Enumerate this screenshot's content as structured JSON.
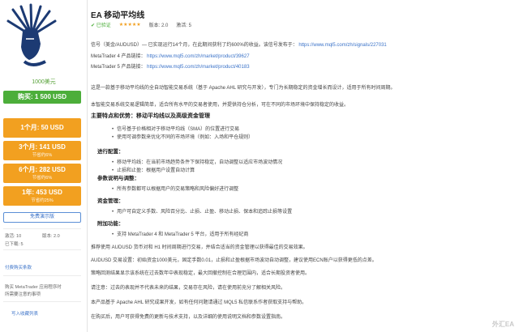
{
  "sidebar": {
    "price_label": "1000美元",
    "buy_label": "购买: 1 500 USD",
    "rent_options": [
      {
        "main": "1个月: 50 USD",
        "sub": ""
      },
      {
        "main": "3个月: 141 USD",
        "sub": "节省约6%"
      },
      {
        "main": "6个月: 282 USD",
        "sub": "节省约6%"
      },
      {
        "main": "1年: 453 USD",
        "sub": "节省约25%"
      }
    ],
    "demo_label": "免费演示版",
    "activations": "激活: 10",
    "version_label": "版本: 2.0",
    "downloads_label": "已下载: 5",
    "terms_link": "付费购买条款",
    "info_1": "购买 MetaTrader 应用程序时",
    "info_2": "所需要注意的事项",
    "subscribe_link": "写入收藏列表"
  },
  "header": {
    "title": "EA 移动平均线",
    "verified": "✔ 已验证",
    "version": "版本: 2.0",
    "activations": "激活: 5",
    "stars": "★★★★★"
  },
  "body": {
    "p1": "信号（美金/AUDUSD）— 已实现运行14个月，在此期间获利了约600%的收益。该信号发布于：",
    "p1_link": "https://www.mql5.com/zh/signals/227031",
    "p2_label": "MetaTrader 4 产品链接：",
    "p2_link": "https://www.mql5.com/zh/market/product/39627",
    "p3_label": "MetaTrader 5 产品链接：",
    "p3_link": "https://www.mql5.com/zh/market/product/40183",
    "p4": "这是一款基于移动平均线的全自动智能交易系统（基于 Apache AHL 研究与开发），专门为长期稳定的资金增长而设计，适用于所有时间周期。",
    "p5": "本智能交易系统交易逻辑简单，适合所有水平的交易者使用，并提供持仓分析，可在不同的市场环境中保持稳定的收益。",
    "h1": "主要特点和优势：移动平均线以及高级资金管理",
    "b1": "信号基于价格相对于移动平均线（SMA）的位置进行交易",
    "b2": "使用可调参数来优化不同的市场环境（例如：入场和平仓规则）",
    "h2": "进行配置：",
    "b3": "移动平均线：在当前市场趋势条件下保持稳定，自动调整以适应市场波动情况",
    "b4": "止损和止盈：根据用户设置自动计算",
    "h3": "参数说明与调整：",
    "b5": "所有参数都可以根据用户的交易策略和风险偏好进行调整",
    "h4": "资金管理：",
    "b6": "用户可自定义手数、风险百分比、止损、止盈、移动止损、保本和追踪止损等设置",
    "h5": "附加功能：",
    "b7": "支持 MetaTrader 4 和 MetaTrader 5 平台，适用于所有经纪商",
    "p6": "推荐使用 AUDUSD 货币对和 H1 时间周期进行交易，并结合适当的资金管理以获得最佳的交易效果。",
    "p7": "AUDUSD 交易设置：初始资金1000美元，固定手数0.01，止损和止盈根据市场波动自动调整，建议使用ECN账户以获得更低的点差。",
    "p8": "策略回测结果显示该系统在过去数年中表现稳定，最大回撤控制在合理范围内，适合长期投资者使用。",
    "p9": "请注意：过去的表现并不代表未来的结果，交易存在风险，请在使用前充分了解相关风险。",
    "p10": "本产品基于 Apache AHL 研究成果开发，如有任何问题请通过 MQL5 私信联系作者获取支持与帮助。",
    "p11": "在购买后，用户可获得免费的更新与技术支持，以及详细的使用说明文档和参数设置指南。"
  },
  "watermark": "外汇EA"
}
